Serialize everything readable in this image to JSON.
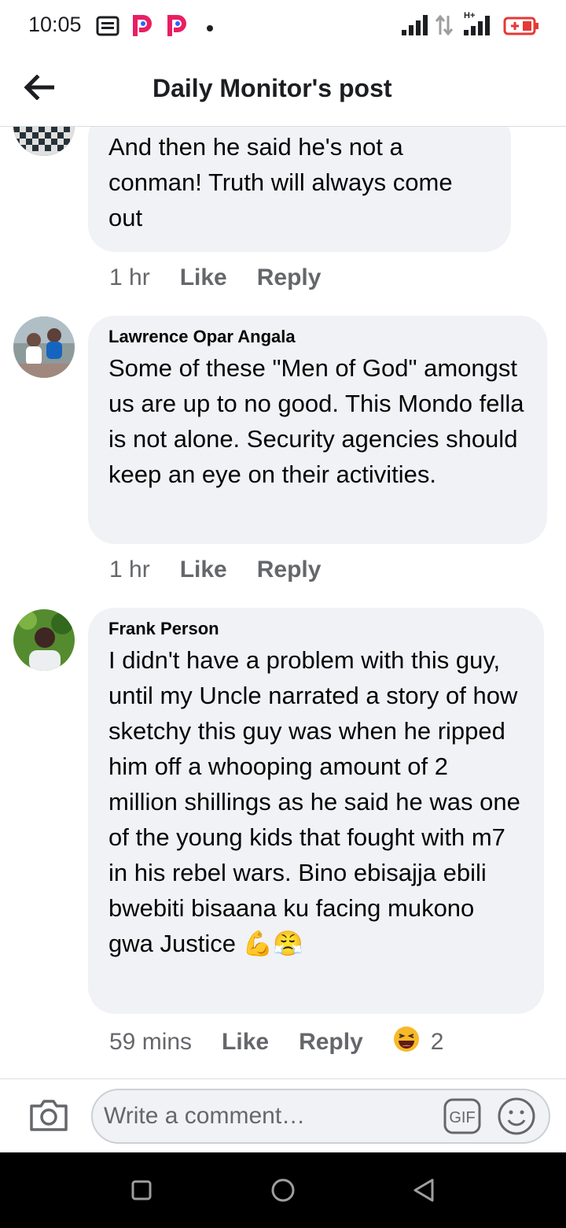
{
  "status_bar": {
    "time": "10:05",
    "left_icons": [
      "notification-icon",
      "pocket-p-icon",
      "pocket-p-icon",
      "dot-icon"
    ],
    "right_icons": [
      "signal-icon",
      "data-arrows-icon",
      "hplus-signal-icon",
      "battery-icon"
    ],
    "network_label": "H+"
  },
  "header": {
    "title": "Daily Monitor's post",
    "back_icon": "arrow-left-icon"
  },
  "comments": [
    {
      "author": "",
      "text": "And then he said he's not a conman! Truth will always come out",
      "time": "1 hr",
      "like": "Like",
      "reply": "Reply"
    },
    {
      "author": "Lawrence Opar Angala",
      "text": "Some of these \"Men of God\" amongst us are up to no good. This Mondo fella is not alone. Security agencies should keep an eye on their activities.",
      "time": "1 hr",
      "like": "Like",
      "reply": "Reply"
    },
    {
      "author": "Frank Person",
      "text": "I didn't have a problem with this guy, until my Uncle narrated a story of how sketchy this guy was when he ripped him off a whooping amount of 2 million shillings as he said he was one of the young kids that fought with m7 in his rebel wars. Bino ebisajja ebili bwebiti bisaana ku facing mukono gwa Justice",
      "emojis": "💪😤",
      "time": "59 mins",
      "like": "Like",
      "reply": "Reply",
      "reaction_icon": "haha-reaction-icon",
      "reaction_count": "2"
    }
  ],
  "composer": {
    "placeholder": "Write a comment…",
    "gif_label": "GIF",
    "camera_icon": "camera-icon",
    "emoji_icon": "smiley-icon"
  },
  "nav": {
    "icons": [
      "recents-square-icon",
      "home-circle-icon",
      "back-triangle-icon"
    ]
  },
  "colors": {
    "bubble": "#f0f2f5",
    "meta_text": "#65676b",
    "battery_red": "#e53935"
  }
}
